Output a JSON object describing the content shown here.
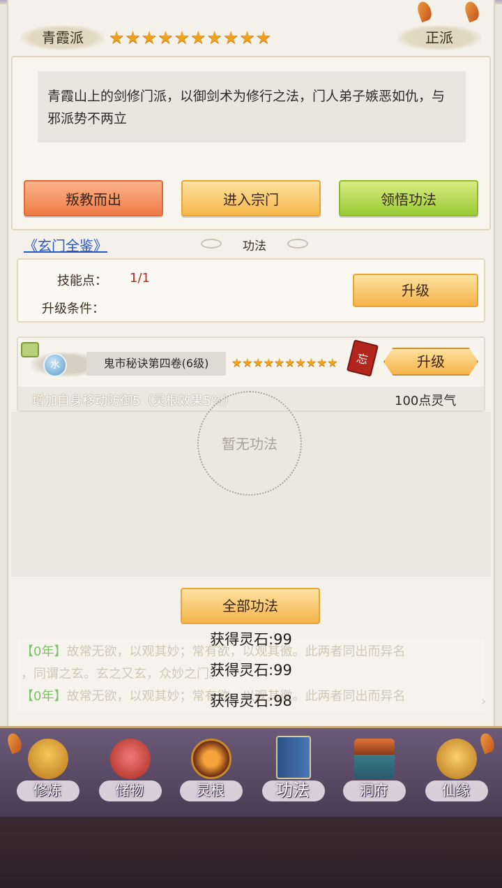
{
  "sect": {
    "name": "青霞派",
    "alignment": "正派",
    "star_count": 10,
    "description": "青霞山上的剑修门派，以御剑术为修行之法，门人弟子嫉恶如仇，与邪派势不两立"
  },
  "actions": {
    "betray_label": "叛教而出",
    "enter_label": "进入宗门",
    "comprehend_label": "领悟功法"
  },
  "codex_link": "《玄门全鉴》",
  "section_title": "功法",
  "skill": {
    "points_label": "技能点：",
    "points_value": "1/1",
    "condition_label": "升级条件：",
    "upgrade_label": "升级"
  },
  "technique": {
    "element": "水",
    "name": "鬼市秘诀第四卷(6级)",
    "star_count": 10,
    "forget_label": "忘",
    "upgrade_label": "升级",
    "effect": "增加自身移动防御5（灵根效果5%）",
    "cost": "100点灵气"
  },
  "empty_text": "暂无功法",
  "all_techniques_label": "全部功法",
  "log": {
    "rows": [
      {
        "year": "【0年】",
        "text": "故常无欲，以观其妙；常有欲，以观其徼。此两者同出而异名"
      },
      {
        "year": "",
        "text": "，同谓之玄。玄之又玄，众妙之门。"
      },
      {
        "year": "【0年】",
        "text": "故常无欲，以观其妙；常有欲，以观其徼。此两者同出而异名"
      }
    ],
    "gains": [
      "获得灵石:99",
      "获得灵石:99",
      "获得灵石:98"
    ]
  },
  "nav": [
    {
      "label": "修炼",
      "icon": "meditation-icon"
    },
    {
      "label": "储物",
      "icon": "storage-bag-icon"
    },
    {
      "label": "灵根",
      "icon": "spirit-root-icon"
    },
    {
      "label": "功法",
      "icon": "technique-book-icon",
      "active": true
    },
    {
      "label": "洞府",
      "icon": "cave-mansion-icon"
    },
    {
      "label": "仙缘",
      "icon": "immortal-fate-icon"
    }
  ],
  "colors": {
    "accent_gold": "#f5b34a",
    "accent_red": "#f07a46",
    "accent_green": "#9acb36",
    "link_blue": "#2a57c9",
    "nav_purple": "#5a4866"
  }
}
